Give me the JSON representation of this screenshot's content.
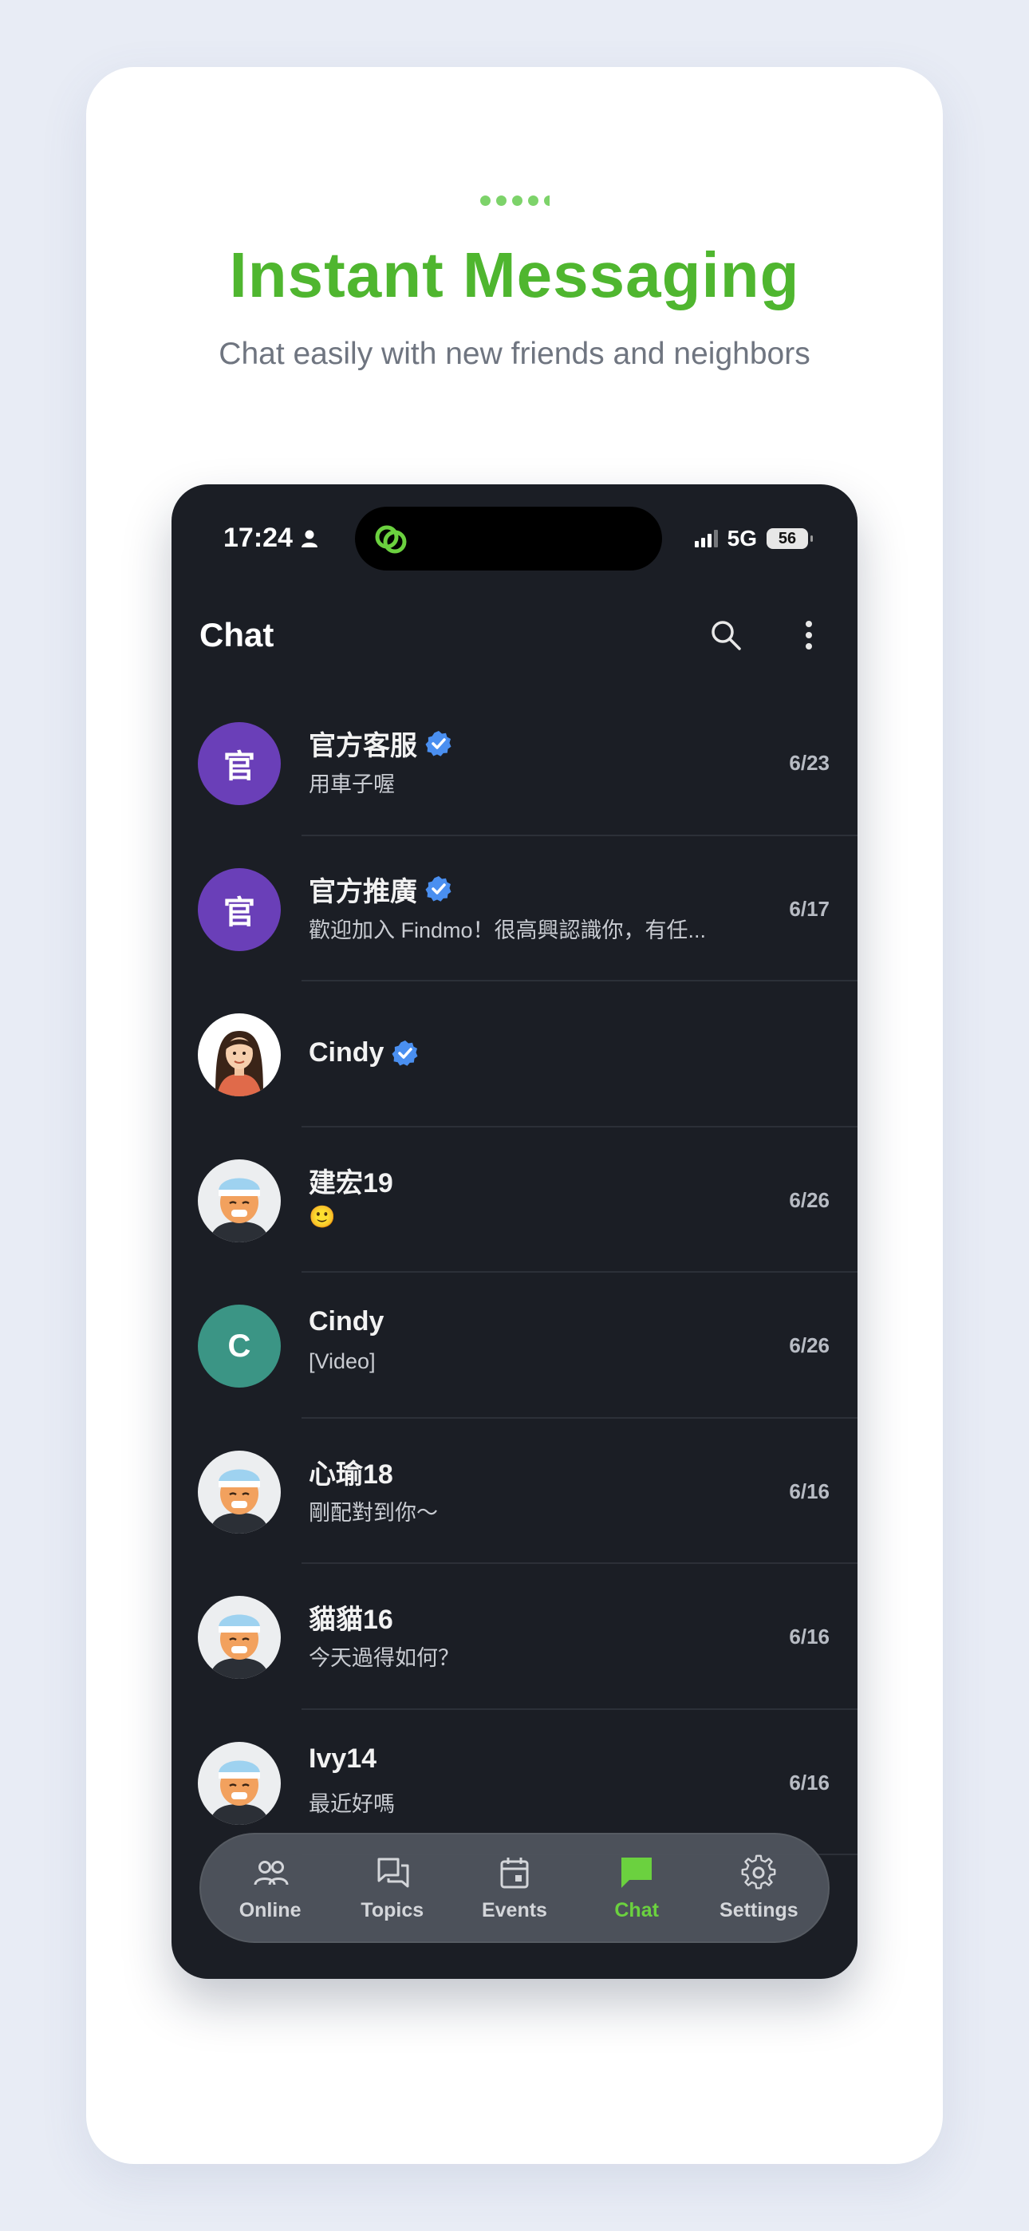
{
  "promo": {
    "headline": "Instant Messaging",
    "subline": "Chat easily with new friends and neighbors"
  },
  "status_bar": {
    "time": "17:24",
    "network": "5G",
    "battery": "56"
  },
  "app": {
    "title": "Chat"
  },
  "chats": [
    {
      "avatar_text": "官",
      "avatar_color": "#6a3fb8",
      "name": "官方客服",
      "verified": true,
      "preview": "用車子喔",
      "date": "6/23"
    },
    {
      "avatar_text": "官",
      "avatar_color": "#6a3fb8",
      "name": "官方推廣",
      "verified": true,
      "preview": "歡迎加入 Findmo！很高興認識你，有任...",
      "date": "6/17"
    },
    {
      "avatar_icon": "woman-avatar",
      "name": "Cindy",
      "verified": true,
      "preview": "",
      "date": ""
    },
    {
      "avatar_icon": "man-avatar",
      "name": "建宏19",
      "verified": false,
      "preview": "🙂",
      "date": "6/26"
    },
    {
      "avatar_text": "C",
      "avatar_color": "#3b9585",
      "name": "Cindy",
      "verified": false,
      "preview": "[Video]",
      "date": "6/26"
    },
    {
      "avatar_icon": "man-avatar",
      "name": "心瑜18",
      "verified": false,
      "preview": "剛配對到你～",
      "date": "6/16"
    },
    {
      "avatar_icon": "man-avatar",
      "name": "貓貓16",
      "verified": false,
      "preview": "今天過得如何？",
      "date": "6/16"
    },
    {
      "avatar_icon": "man-avatar",
      "name": "Ivy14",
      "verified": false,
      "preview": "最近好嗎",
      "date": "6/16"
    }
  ],
  "tabs": [
    {
      "label": "Online",
      "icon": "people-icon",
      "active": false
    },
    {
      "label": "Topics",
      "icon": "topics-icon",
      "active": false
    },
    {
      "label": "Events",
      "icon": "calendar-icon",
      "active": false
    },
    {
      "label": "Chat",
      "icon": "chat-icon",
      "active": true
    },
    {
      "label": "Settings",
      "icon": "gear-icon",
      "active": false
    }
  ],
  "colors": {
    "accent": "#4fb62f",
    "active_tab": "#6bd13f",
    "verified": "#4a8ff0",
    "phone_bg": "#1b1e25"
  }
}
